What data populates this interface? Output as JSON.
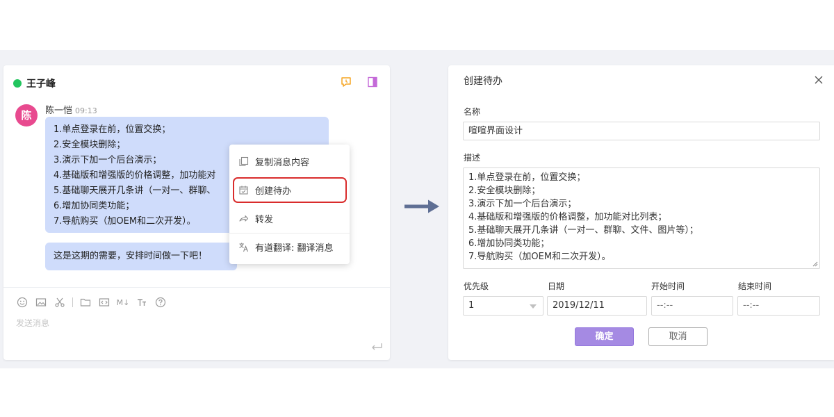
{
  "chat": {
    "contact_name": "王子峰",
    "status_color": "#22c55e",
    "avatar_text": "陈",
    "avatar_color": "#e84a8f",
    "sender_name": "陈一恺",
    "sender_time": "09:13",
    "message_lines": [
      "1.单点登录在前，位置交换；",
      "2.安全模块删除；",
      "3.演示下加一个后台演示；",
      "4.基础版和增强版的价格调整，加功能对",
      "5.基础聊天展开几条讲（一对一、群聊、",
      "6.增加协同类功能；",
      "7.导航购买（加OEM和二次开发）。"
    ],
    "message2": "这是这期的需要，安排时间做一下吧！",
    "toolbar_icons": [
      "emoji-icon",
      "image-icon",
      "scissors-icon",
      "folder-icon",
      "code-icon",
      "markdown-icon",
      "text-format-icon",
      "help-icon"
    ],
    "toolbar_md_label": "M↓",
    "input_placeholder": "发送消息",
    "bubble_color": "#cfdcfb"
  },
  "context_menu": {
    "items": [
      {
        "icon": "copy-icon",
        "label": "复制消息内容"
      },
      {
        "icon": "calendar-check-icon",
        "label": "创建待办"
      },
      {
        "icon": "forward-icon",
        "label": "转发"
      },
      {
        "icon": "translate-icon",
        "label": "有道翻译: 翻译消息"
      }
    ],
    "highlight_color": "#d92c2c"
  },
  "dialog": {
    "title": "创建待办",
    "name_label": "名称",
    "name_value": "喧喧界面设计",
    "desc_label": "描述",
    "desc_lines": [
      "1.单点登录在前，位置交换；",
      "2.安全模块删除；",
      "3.演示下加一个后台演示；",
      "4.基础版和增强版的价格调整，加功能对比列表；",
      "5.基础聊天展开几条讲（一对一、群聊、文件、图片等）；",
      "6.增加协同类功能；",
      "7.导航购买（加OEM和二次开发）。"
    ],
    "priority_label": "优先级",
    "priority_value": "1",
    "date_label": "日期",
    "date_value": "2019/12/11",
    "start_label": "开始时间",
    "start_value": "--:--",
    "end_label": "结束时间",
    "end_value": "--:--",
    "ok_label": "确定",
    "cancel_label": "取消",
    "accent_color": "#a58ae3"
  }
}
